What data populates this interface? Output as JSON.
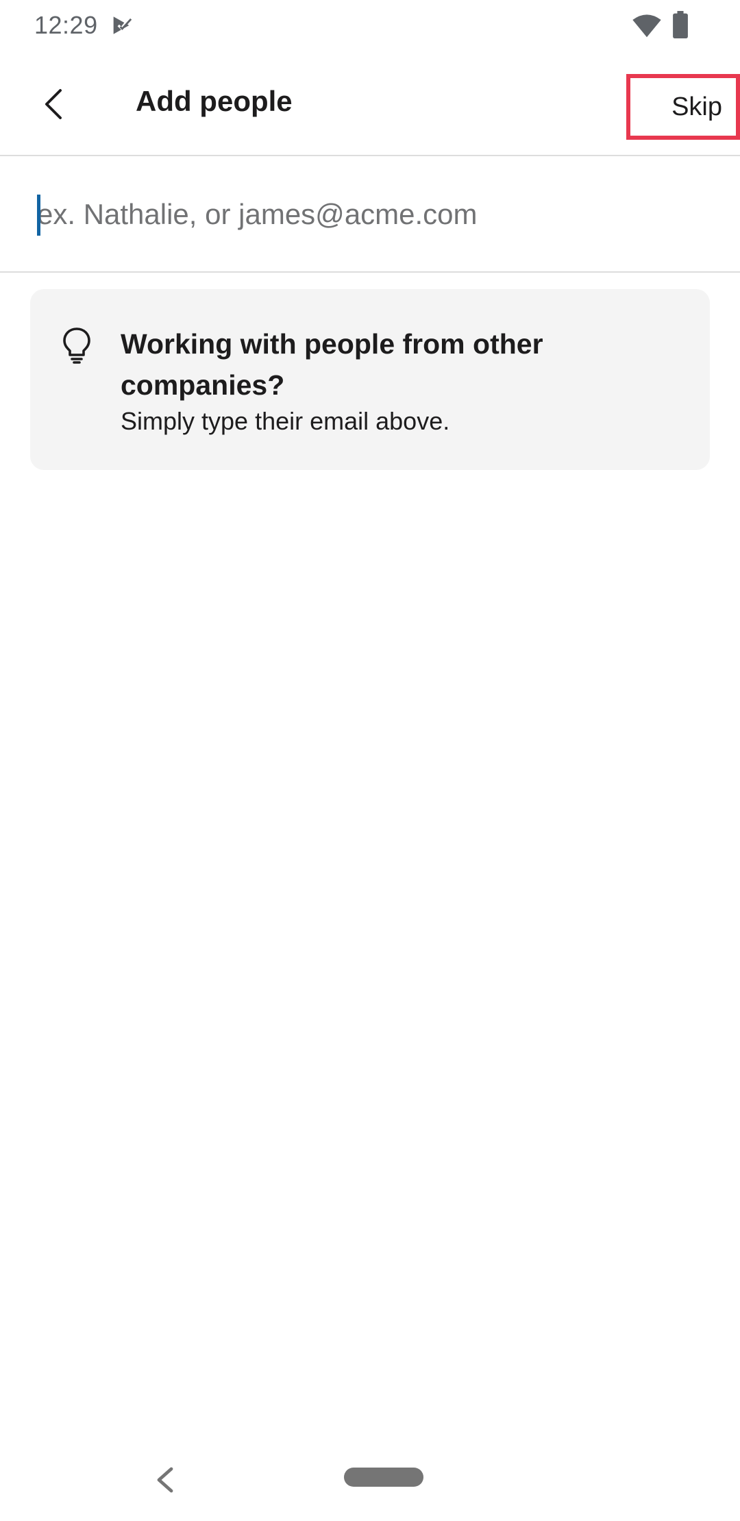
{
  "status_bar": {
    "time": "12:29",
    "icons": [
      "notification-check-icon",
      "wifi-icon",
      "battery-icon"
    ]
  },
  "app_bar": {
    "title": "Add people",
    "back_icon": "chevron-left-icon",
    "skip_label": "Skip"
  },
  "search": {
    "value": "",
    "placeholder": "ex. Nathalie, or james@acme.com"
  },
  "tip": {
    "icon": "lightbulb-icon",
    "title": "Working with people from other companies?",
    "body": "Simply type their email above."
  },
  "nav_bar": {
    "icons": [
      "nav-back-icon",
      "home-pill-icon"
    ]
  },
  "colors": {
    "highlight_border": "#e8384f",
    "cursor": "#1264a3",
    "tip_background": "#f4f4f4",
    "divider": "#dddddd"
  }
}
